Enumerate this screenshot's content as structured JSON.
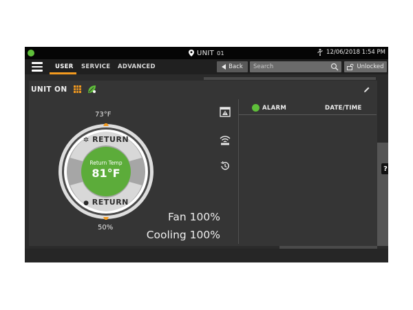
{
  "statusbar": {
    "unit_label": "UNIT",
    "unit_number": "01",
    "datetime": "12/06/2018 1:54 PM",
    "status_color": "#5fbf3a"
  },
  "nav": {
    "tabs": [
      {
        "label": "USER",
        "active": true
      },
      {
        "label": "SERVICE",
        "active": false
      },
      {
        "label": "ADVANCED",
        "active": false
      }
    ],
    "back_label": "Back",
    "search_placeholder": "Search",
    "lock_label": "Unlocked",
    "accent_color": "#f39a1f"
  },
  "unit": {
    "status": "UNIT ON"
  },
  "dial": {
    "setpoint_high": "73°F",
    "setpoint_low": "50%",
    "center_caption": "Return Temp",
    "center_value": "81°F",
    "top_arc_label": "RETURN",
    "bottom_arc_label": "RETURN",
    "center_color": "#5cac3a"
  },
  "metrics": {
    "fan": "Fan 100%",
    "cooling": "Cooling 100%"
  },
  "alarms": {
    "col_alarm": "ALARM",
    "col_datetime": "DATE/TIME",
    "indicator_color": "#5fbf3a"
  },
  "help": {
    "label": "?"
  }
}
